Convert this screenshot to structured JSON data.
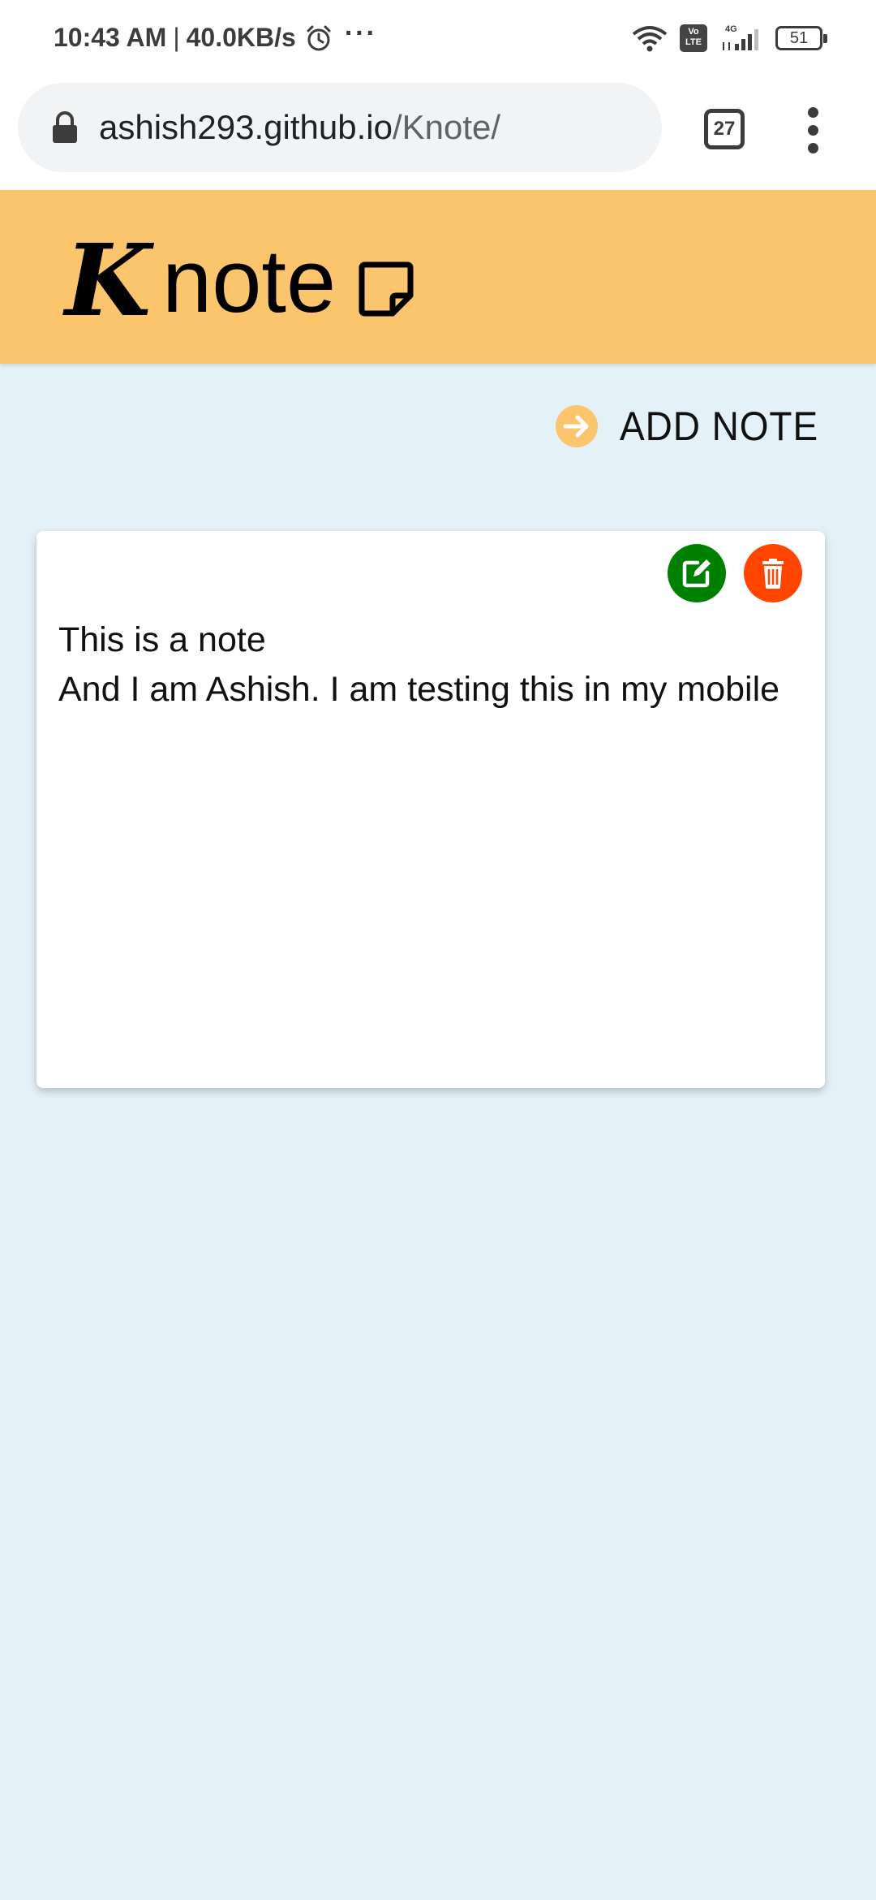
{
  "status_bar": {
    "time": "10:43 AM",
    "separator": "|",
    "network_speed": "40.0KB/s",
    "more_indicator": "···",
    "volte_label": "Vo LTE",
    "signal_label": "4G",
    "battery_level": "51",
    "icons": [
      "alarm-icon",
      "wifi-icon",
      "volte-icon",
      "signal-icon",
      "battery-icon"
    ]
  },
  "browser": {
    "url_host": "ashish293.github.io",
    "url_path": "/Knote/",
    "tab_count": "27",
    "icons": [
      "lock-icon",
      "tab-switcher-icon",
      "menu-kebab-icon"
    ]
  },
  "header": {
    "brand_letter": "K",
    "brand_text": "note",
    "background_color": "#fbc56e",
    "icon": "sticky-note-icon"
  },
  "toolbar": {
    "add_note_label": "ADD NOTE",
    "add_note_icon": "arrow-circle-right-icon",
    "accent_color": "#fbc56e"
  },
  "notes": [
    {
      "lines": [
        "This is a note",
        "And I am Ashish. I am testing this in my mobile"
      ],
      "edit_icon": "edit-icon",
      "edit_color": "#008000",
      "delete_icon": "trash-icon",
      "delete_color": "#ff4500"
    }
  ],
  "page_background": "#e5f1f8"
}
